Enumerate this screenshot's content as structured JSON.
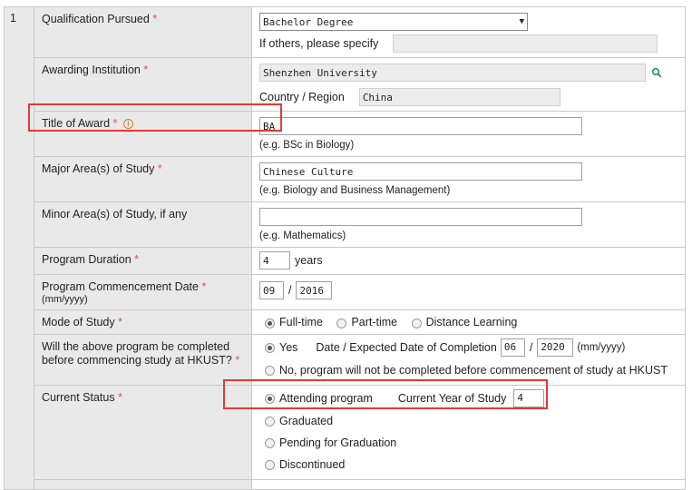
{
  "row_number": "1",
  "qualification": {
    "label": "Qualification Pursued",
    "required_mark": "*",
    "selected": "Bachelor Degree",
    "others_label": "If others, please specify",
    "others_value": ""
  },
  "institution": {
    "label": "Awarding Institution",
    "required_mark": "*",
    "value": "Shenzhen University",
    "country_label": "Country / Region",
    "country_value": "China"
  },
  "title_of_award": {
    "label": "Title of Award",
    "required_mark": "*",
    "value": "BA",
    "hint": "(e.g. BSc in Biology)"
  },
  "major": {
    "label": "Major Area(s) of Study",
    "required_mark": "*",
    "value": "Chinese Culture",
    "hint": "(e.g. Biology and Business Management)"
  },
  "minor": {
    "label": "Minor Area(s) of Study, if any",
    "value": "",
    "hint": "(e.g. Mathematics)"
  },
  "duration": {
    "label": "Program Duration",
    "required_mark": "*",
    "value": "4",
    "unit": "years"
  },
  "commencement": {
    "label": "Program Commencement Date",
    "required_mark": "*",
    "format": "(mm/yyyy)",
    "month": "09",
    "separator": "/",
    "year": "2016"
  },
  "mode_of_study": {
    "label": "Mode of Study",
    "required_mark": "*",
    "options": [
      "Full-time",
      "Part-time",
      "Distance Learning"
    ],
    "selected_index": 0
  },
  "completion": {
    "label": "Will the above program be completed before commencing study at HKUST?",
    "required_mark": "*",
    "yes_label": "Yes",
    "date_label": "Date / Expected Date of Completion",
    "month": "06",
    "separator": "/",
    "year": "2020",
    "format": "(mm/yyyy)",
    "no_label": "No, program will not be completed before commencement of study at HKUST"
  },
  "current_status": {
    "label": "Current Status",
    "required_mark": "*",
    "options": [
      "Attending program",
      "Graduated",
      "Pending for Graduation",
      "Discontinued"
    ],
    "selected_index": 0,
    "year_label": "Current Year of Study",
    "year_value": "4"
  },
  "colors": {
    "highlight": "#e53935",
    "required": "#d9534f",
    "info_icon": "#e07a1f",
    "search_icon": "#2e8b57",
    "label_bg": "#e9e9e9"
  },
  "icons": {
    "info": "info-circle-icon",
    "search": "search-icon",
    "dropdown": "dropdown-arrow-icon"
  },
  "glyphs": {
    "info": "i",
    "dropdown": "▼"
  }
}
